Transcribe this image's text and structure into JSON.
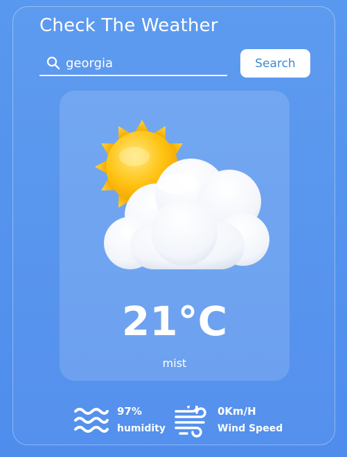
{
  "app": {
    "title": "Check The Weather"
  },
  "search": {
    "value": "georgia",
    "placeholder": "",
    "button_label": "Search",
    "icon": "search-icon"
  },
  "weather": {
    "temperature": "21°C",
    "description": "mist",
    "icon": "sun-behind-cloud-icon"
  },
  "stats": {
    "humidity": {
      "value": "97%",
      "label": "humidity",
      "icon": "waves-icon"
    },
    "wind": {
      "value": "0Km/H",
      "label": "Wind Speed",
      "icon": "wind-icon"
    }
  },
  "colors": {
    "background": "#5694ee",
    "accent": "#3a8ad8",
    "text": "#ffffff"
  }
}
